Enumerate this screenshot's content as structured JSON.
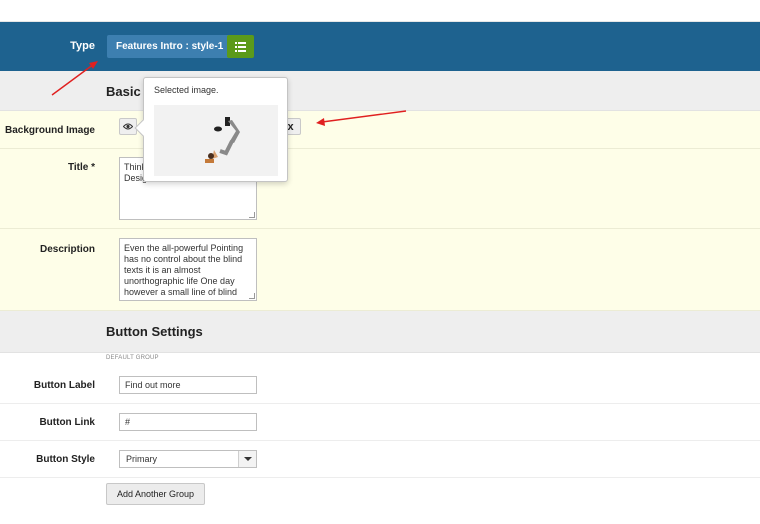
{
  "type_bar": {
    "label": "Type",
    "value": "Features Intro : style-1",
    "list_icon": "list-icon"
  },
  "basic_section": {
    "title": "Basic S"
  },
  "background_image": {
    "label": "Background Image",
    "view_icon": "eye-icon",
    "remove_icon": "close-icon",
    "remove_text": "x"
  },
  "popover": {
    "title": "Selected image."
  },
  "title_field": {
    "label": "Title *",
    "lines": [
      "Think",
      "Desig"
    ]
  },
  "description_field": {
    "label": "Description",
    "value": "Even the all-powerful Pointing has no control about the blind texts it is an almost unorthographic life One day however a small line of blind"
  },
  "button_section": {
    "title": "Button Settings",
    "group_caption": "DEFAULT GROUP"
  },
  "button_label": {
    "label": "Button Label",
    "value": "Find out more"
  },
  "button_link": {
    "label": "Button Link",
    "value": "#"
  },
  "button_style": {
    "label": "Button Style",
    "value": "Primary"
  },
  "add_group": {
    "label": "Add Another Group"
  },
  "colors": {
    "header_blue": "#1e628f",
    "green_button": "#5b9a1a",
    "highlight_yellow": "#fefee8",
    "annotation_red": "#e02020"
  }
}
